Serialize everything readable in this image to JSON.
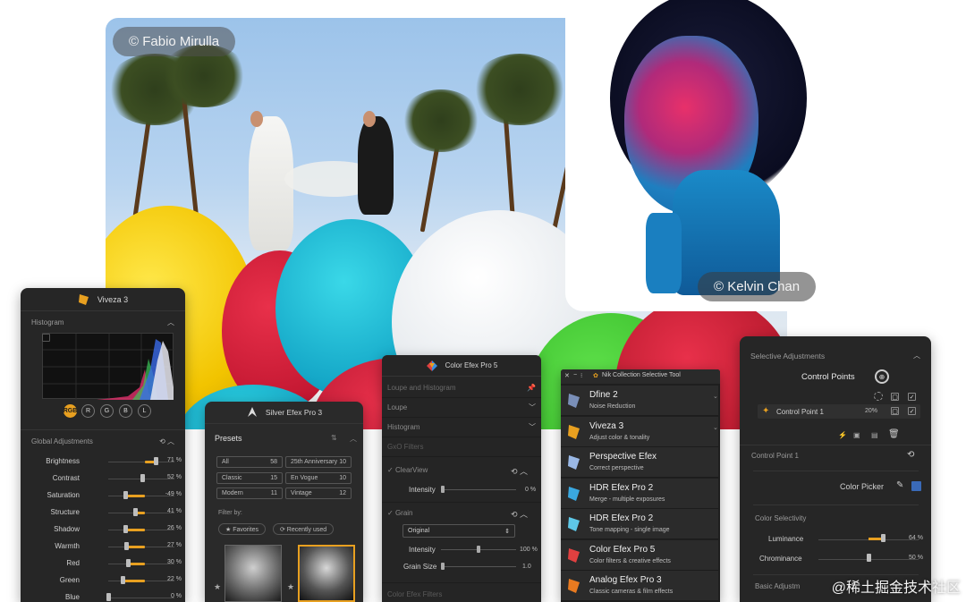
{
  "photos": {
    "wedding_credit": "© Fabio Mirulla",
    "portrait_credit": "© Kelvin Chan"
  },
  "viveza": {
    "title": "Viveza 3",
    "histogram_label": "Histogram",
    "channels": [
      "RGB",
      "R",
      "G",
      "B",
      "L"
    ],
    "global_label": "Global Adjustments",
    "sliders": [
      {
        "label": "Brightness",
        "value": "71 %",
        "fraction": 0.71
      },
      {
        "label": "Contrast",
        "value": "52 %",
        "fraction": 0.52
      },
      {
        "label": "Saturation",
        "value": "-49 %",
        "fraction": 0.25
      },
      {
        "label": "Structure",
        "value": "41 %",
        "fraction": 0.41
      },
      {
        "label": "Shadow",
        "value": "26 %",
        "fraction": 0.26
      },
      {
        "label": "Warmth",
        "value": "27 %",
        "fraction": 0.27
      },
      {
        "label": "Red",
        "value": "30 %",
        "fraction": 0.3
      },
      {
        "label": "Green",
        "value": "22 %",
        "fraction": 0.22
      },
      {
        "label": "Blue",
        "value": "0 %",
        "fraction": 0.0
      }
    ]
  },
  "silver": {
    "title": "Silver Efex Pro 3",
    "presets_label": "Presets",
    "presets": [
      {
        "name": "All",
        "count": "58"
      },
      {
        "name": "25th Anniversary",
        "count": "10"
      },
      {
        "name": "Classic",
        "count": "15"
      },
      {
        "name": "En Vogue",
        "count": "10"
      },
      {
        "name": "Modern",
        "count": "11"
      },
      {
        "name": "Vintage",
        "count": "12"
      }
    ],
    "filter_label": "Filter by:",
    "filters": [
      "★ Favorites",
      "⟳ Recently used"
    ]
  },
  "color_efex": {
    "title": "Color Efex Pro 5",
    "rows": [
      "Loupe and Histogram",
      "Loupe",
      "Histogram",
      "GxO Filters"
    ],
    "clearview": "ClearView",
    "intensity_label": "Intensity",
    "intensity_value": "0 %",
    "grain": "Grain",
    "grain_mode": "Original",
    "grain_intensity_value": "100 %",
    "grain_size_label": "Grain Size",
    "grain_size_value": "1.0",
    "footer": "Color Efex Filters"
  },
  "nik": {
    "title": "Nik Collection Selective Tool",
    "items": [
      {
        "name": "Dfine 2",
        "desc": "Noise Reduction",
        "color": "#7a8fb8"
      },
      {
        "name": "Viveza 3",
        "desc": "Adjust color & tonality",
        "color": "#e8a020"
      },
      {
        "name": "Perspective Efex",
        "desc": "Correct perspective",
        "color": "#9ab8e6"
      },
      {
        "name": "HDR Efex Pro 2",
        "desc": "Merge - multiple exposures",
        "color": "#3aa8e0"
      },
      {
        "name": "HDR Efex Pro 2",
        "desc": "Tone mapping - single image",
        "color": "#5ec8e8"
      },
      {
        "name": "Color Efex Pro 5",
        "desc": "Color filters & creative effects",
        "color": "#e04040"
      },
      {
        "name": "Analog Efex Pro 3",
        "desc": "Classic cameras & film effects",
        "color": "#e87a20"
      }
    ]
  },
  "selective": {
    "title": "Selective Adjustments",
    "control_points_label": "Control Points",
    "cp_item": "Control Point 1",
    "cp_pct": "20%",
    "cp_section": "Control Point 1",
    "color_picker": "Color Picker",
    "color_selectivity": "Color Selectivity",
    "luminance_label": "Luminance",
    "luminance_value": "64 %",
    "luminance_fraction": 0.64,
    "chrominance_label": "Chrominance",
    "chrominance_value": "50 %",
    "chrominance_fraction": 0.5,
    "basic_label": "Basic Adjustm"
  },
  "watermark": "@稀土掘金技术社区",
  "colors": {
    "accent": "#e8a020",
    "panel": "#262626"
  }
}
